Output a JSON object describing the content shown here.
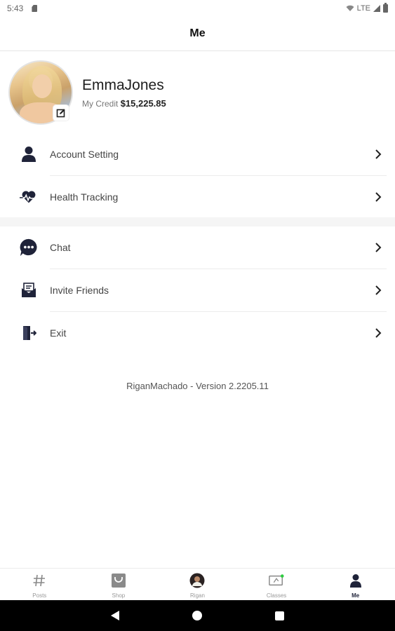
{
  "status_bar": {
    "time": "5:43",
    "network": "LTE"
  },
  "header": {
    "title": "Me"
  },
  "profile": {
    "username": "EmmaJones",
    "credit_label": "My Credit",
    "credit_value": "$15,225.85"
  },
  "menu": {
    "group1": [
      {
        "label": "Account Setting",
        "icon": "person-icon"
      },
      {
        "label": "Health Tracking",
        "icon": "heart-pulse-icon"
      }
    ],
    "group2": [
      {
        "label": "Chat",
        "icon": "chat-bubble-icon"
      },
      {
        "label": "Invite Friends",
        "icon": "envelope-open-icon"
      },
      {
        "label": "Exit",
        "icon": "exit-door-icon"
      }
    ]
  },
  "version_text": "RiganMachado - Version 2.2205.11",
  "bottom_nav": [
    {
      "label": "Posts",
      "icon": "hashtag-icon",
      "active": false
    },
    {
      "label": "Shop",
      "icon": "shopping-bag-icon",
      "active": false
    },
    {
      "label": "Rigan",
      "icon": "rigan-avatar-icon",
      "active": false
    },
    {
      "label": "Classes",
      "icon": "classes-screen-icon",
      "active": false
    },
    {
      "label": "Me",
      "icon": "person-icon",
      "active": true
    }
  ],
  "colors": {
    "icon_dark": "#1f2339",
    "accent_dot": "#2ecc40",
    "divider": "#ececec"
  }
}
